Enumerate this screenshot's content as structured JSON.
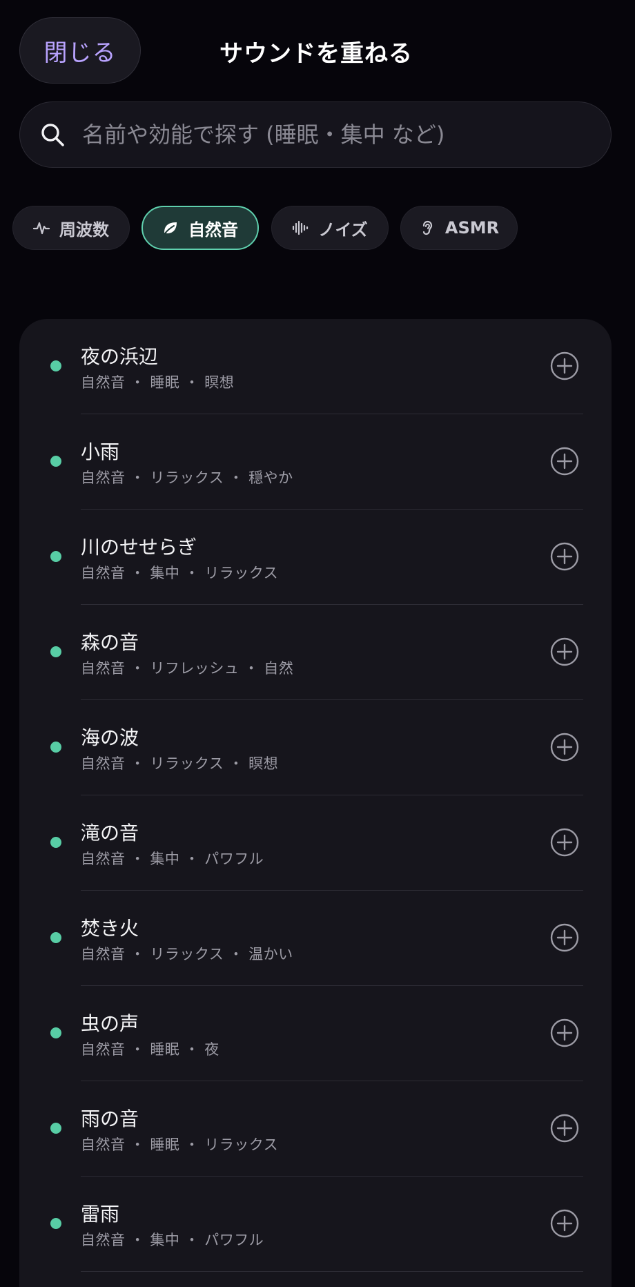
{
  "header": {
    "close_label": "閉じる",
    "title": "サウンドを重ねる"
  },
  "search": {
    "placeholder": "名前や効能で探す (睡眠・集中 など)",
    "value": ""
  },
  "chips": [
    {
      "label": "周波数",
      "icon": "pulse-icon",
      "active": false
    },
    {
      "label": "自然音",
      "icon": "leaf-icon",
      "active": true
    },
    {
      "label": "ノイズ",
      "icon": "waveform-icon",
      "active": false
    },
    {
      "label": "ASMR",
      "icon": "ear-icon",
      "active": false
    }
  ],
  "colors": {
    "accent": "#58cda5",
    "close_text": "#b9a3ff",
    "background": "#06050b"
  },
  "sounds": [
    {
      "name": "夜の浜辺",
      "tags": "自然音 ・ 睡眠 ・ 瞑想"
    },
    {
      "name": "小雨",
      "tags": "自然音 ・ リラックス ・ 穏やか"
    },
    {
      "name": "川のせせらぎ",
      "tags": "自然音 ・ 集中 ・ リラックス"
    },
    {
      "name": "森の音",
      "tags": "自然音 ・ リフレッシュ ・ 自然"
    },
    {
      "name": "海の波",
      "tags": "自然音 ・ リラックス ・ 瞑想"
    },
    {
      "name": "滝の音",
      "tags": "自然音 ・ 集中 ・ パワフル"
    },
    {
      "name": "焚き火",
      "tags": "自然音 ・ リラックス ・ 温かい"
    },
    {
      "name": "虫の声",
      "tags": "自然音 ・ 睡眠 ・ 夜"
    },
    {
      "name": "雨の音",
      "tags": "自然音 ・ 睡眠 ・ リラックス"
    },
    {
      "name": "雷雨",
      "tags": "自然音 ・ 集中 ・ パワフル"
    }
  ]
}
